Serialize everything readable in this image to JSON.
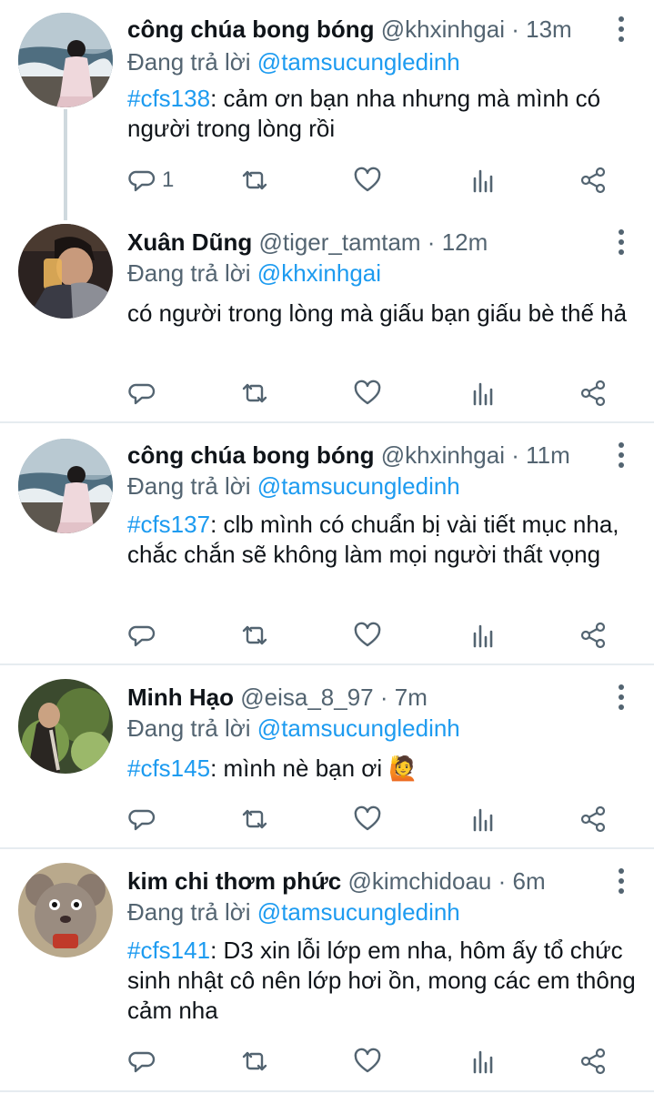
{
  "tweets": [
    {
      "name": "công chúa bong bóng",
      "handle": "@khxinhgai",
      "time": "13m",
      "replying_prefix": "Đang trả lời",
      "replying_to": "@tamsucungledinh",
      "hashtag": "#cfs138",
      "text": ": cảm ơn bạn nha nhưng mà mình có người trong lòng rồi",
      "reply_count": "1",
      "avatar": "girl-at-sea-photo"
    },
    {
      "name": "Xuân Dũng",
      "handle": "@tiger_tamtam",
      "time": "12m",
      "replying_prefix": "Đang trả lời",
      "replying_to": "@khxinhgai",
      "hashtag": "",
      "text": "có người trong lòng mà giấu bạn giấu bè thế hả",
      "reply_count": "",
      "avatar": "man-drinking-photo"
    },
    {
      "name": "công chúa bong bóng",
      "handle": "@khxinhgai",
      "time": "11m",
      "replying_prefix": "Đang trả lời",
      "replying_to": "@tamsucungledinh",
      "hashtag": "#cfs137",
      "text": ": clb mình có chuẩn bị vài tiết mục nha, chắc chắn sẽ không làm mọi người thất vọng",
      "reply_count": "",
      "avatar": "girl-at-sea-photo"
    },
    {
      "name": "Minh Hạo",
      "handle": "@eisa_8_97",
      "time": "7m",
      "replying_prefix": "Đang trả lời",
      "replying_to": "@tamsucungledinh",
      "hashtag": "#cfs145",
      "text": ": mình nè bạn ơi 🙋",
      "reply_count": "",
      "avatar": "person-in-garden-photo"
    },
    {
      "name": "kim chi thơm phức",
      "handle": "@kimchidoau",
      "time": "6m",
      "replying_prefix": "Đang trả lời",
      "replying_to": "@tamsucungledinh",
      "hashtag": "#cfs141",
      "text": ": D3 xin lỗi lớp em nha, hôm ấy tổ chức sinh nhật cô nên lớp hơi ồn, mong các em thông cảm nha",
      "reply_count": "",
      "avatar": "cartoon-mouse-toy-photo"
    }
  ],
  "separator": " · ",
  "colors": {
    "link": "#1d9bf0",
    "muted": "#536471",
    "text": "#0f1419",
    "divider": "#e6ecf0"
  },
  "icons": [
    "reply-icon",
    "retweet-icon",
    "like-icon",
    "analytics-icon",
    "share-icon",
    "more-icon"
  ]
}
